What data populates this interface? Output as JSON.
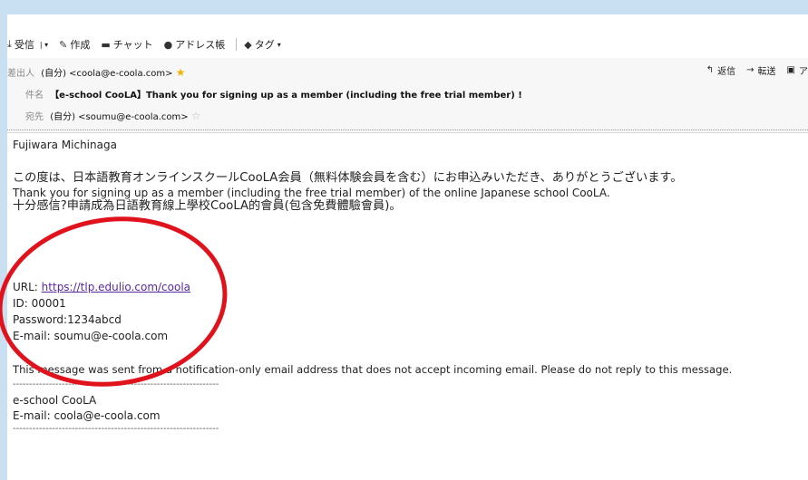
{
  "toolbar": {
    "receive": "受信",
    "compose": "作成",
    "chat": "チャット",
    "addressbook": "アドレス帳",
    "tag": "タグ",
    "reply": "返信",
    "forward": "転送",
    "archive": "ア"
  },
  "header": {
    "from_label": "差出人",
    "from_value": "(自分) <coola@e-coola.com>",
    "subject_label": "件名",
    "subject_value": "【e-school CooLA】Thank you for signing up as a member (including the free trial member) !",
    "to_label": "宛先",
    "to_value": "(自分) <soumu@e-coola.com>"
  },
  "body": {
    "greeting": "Fujiwara Michinaga",
    "line_ja": "この度は、日本語教育オンラインスクールCooLA会員（無料体験会員を含む）にお申込みいただき、ありがとうございます。",
    "line_en": "Thank you for signing up as a member (including the free trial member) of the online Japanese school CooLA.",
    "line_zh": "十分感信?申請成為日語教育線上學校CooLA的會員(包含免費體驗會員)。",
    "url_label": "URL: ",
    "url_value": "https://tlp.edulio.com/coola",
    "id_line": "ID: 00001",
    "password_line": "Password:1234abcd",
    "email_line": "E-mail: soumu@e-coola.com",
    "notice": "This message was sent from a notification-only email address that does not accept incoming email. Please do not reply to this message.",
    "divider": "---------------------------------------------------------------",
    "sig_name": "e-school CooLA",
    "sig_email": "E-mail: coola@e-coola.com"
  },
  "colors": {
    "annotation_circle": "#e0121c",
    "link": "#5a28a0",
    "star": "#f1b400"
  }
}
